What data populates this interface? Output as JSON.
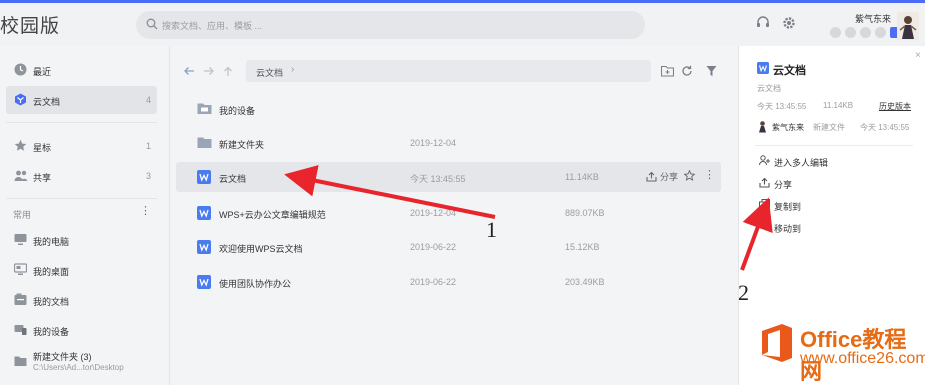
{
  "app": {
    "brand": "校园版",
    "accent_color": "#4a6cf7"
  },
  "search": {
    "placeholder": "搜索文档、应用、模板 ..."
  },
  "user": {
    "name": "紫气东来"
  },
  "sidebar": {
    "items": [
      {
        "label": "最近",
        "icon": "clock-icon",
        "count": ""
      },
      {
        "label": "云文档",
        "icon": "cloud-doc-icon",
        "count": "4"
      },
      {
        "label": "星标",
        "icon": "star-icon",
        "count": "1"
      },
      {
        "label": "共享",
        "icon": "people-icon",
        "count": "3"
      }
    ],
    "common_label": "常用",
    "common_items": [
      {
        "label": "我的电脑",
        "icon": "computer-icon"
      },
      {
        "label": "我的桌面",
        "icon": "desktop-icon"
      },
      {
        "label": "我的文档",
        "icon": "documents-icon"
      },
      {
        "label": "我的设备",
        "icon": "device-icon"
      },
      {
        "label": "新建文件夹 (3)",
        "icon": "folder-icon",
        "path": "C:\\Users\\Ad...tor\\Desktop"
      }
    ]
  },
  "main": {
    "breadcrumb": "云文档",
    "files": [
      {
        "name": "我的设备",
        "icon": "device-folder-icon",
        "date": "",
        "size": ""
      },
      {
        "name": "新建文件夹",
        "icon": "folder-icon",
        "date": "2019-12-04",
        "size": ""
      },
      {
        "name": "云文档",
        "icon": "wps-doc-icon",
        "date": "今天 13:45:55",
        "size": "11.14KB",
        "share": "分享"
      },
      {
        "name": "WPS+云办公文章编辑规范",
        "icon": "wps-doc-icon",
        "date": "2019-12-04",
        "size": "889.07KB"
      },
      {
        "name": "欢迎使用WPS云文档",
        "icon": "wps-doc-icon",
        "date": "2019-06-22",
        "size": "15.12KB"
      },
      {
        "name": "使用团队协作办公",
        "icon": "wps-doc-icon",
        "date": "2019-06-22",
        "size": "203.49KB"
      }
    ]
  },
  "panel": {
    "title": "云文档",
    "location": "云文档",
    "modified": "今天 13:45:55",
    "size": "11.14KB",
    "history": "历史版本",
    "user": "紫气东来",
    "action_text": "新建文件",
    "action_time": "今天 13:45:55",
    "actions": [
      {
        "label": "进入多人编辑",
        "icon": "add-user-icon"
      },
      {
        "label": "分享",
        "icon": "share-icon"
      },
      {
        "label": "复制到",
        "icon": "copy-icon"
      },
      {
        "label": "移动到",
        "icon": "move-icon"
      }
    ]
  },
  "annotations": {
    "one": "1",
    "two": "2"
  },
  "watermark": {
    "line1": "Office教程网",
    "line2": "www.office26.com"
  }
}
